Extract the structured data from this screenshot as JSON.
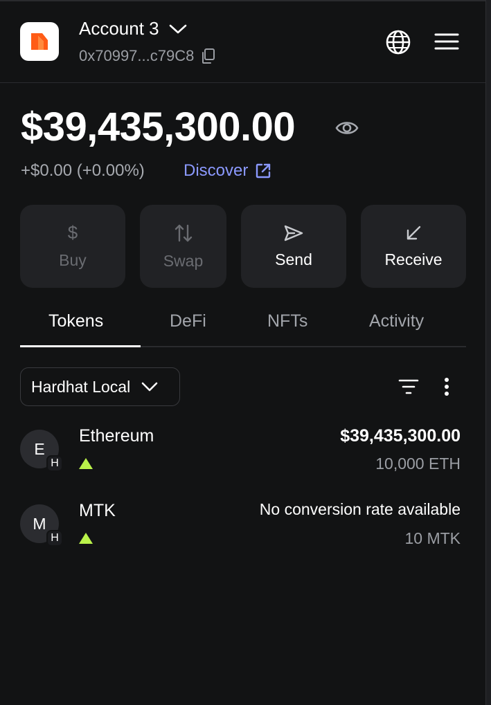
{
  "header": {
    "account_name": "Account 3",
    "address": "0x70997...c79C8"
  },
  "balance": {
    "total": "$39,435,300.00",
    "change": "+$0.00 (+0.00%)",
    "discover_label": "Discover"
  },
  "actions": [
    {
      "label": "Buy",
      "icon": "dollar-icon",
      "enabled": false
    },
    {
      "label": "Swap",
      "icon": "swap-icon",
      "enabled": false
    },
    {
      "label": "Send",
      "icon": "send-icon",
      "enabled": true
    },
    {
      "label": "Receive",
      "icon": "receive-icon",
      "enabled": true
    }
  ],
  "tabs": [
    {
      "label": "Tokens",
      "active": true
    },
    {
      "label": "DeFi",
      "active": false
    },
    {
      "label": "NFTs",
      "active": false
    },
    {
      "label": "Activity",
      "active": false
    }
  ],
  "network_filter": {
    "selected": "Hardhat Local"
  },
  "tokens": [
    {
      "initial": "E",
      "badge": "H",
      "name": "Ethereum",
      "fiat": "$39,435,300.00",
      "amount": "10,000 ETH"
    },
    {
      "initial": "M",
      "badge": "H",
      "name": "MTK",
      "fiat": "No conversion rate available",
      "amount": "10 MTK"
    }
  ],
  "colors": {
    "background": "#121314",
    "accent_link": "#8b99ff",
    "brand_orange": "#ff5c16",
    "up_arrow": "#baf24a",
    "button_bg": "#212225"
  }
}
